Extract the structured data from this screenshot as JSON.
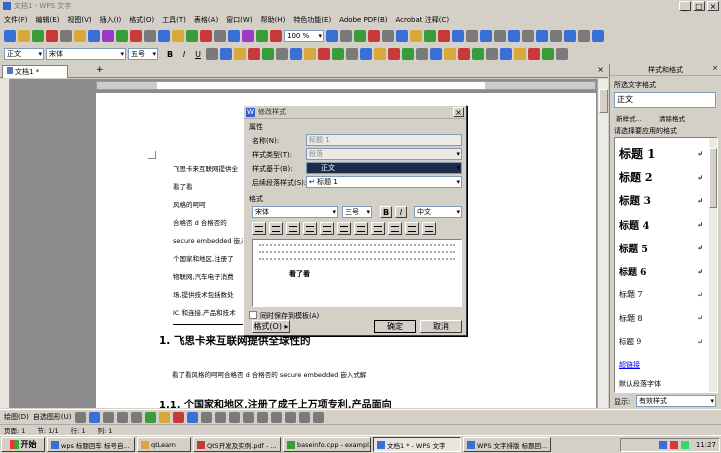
{
  "window": {
    "title": "文档1 - WPS 文字",
    "controls": [
      "_",
      "□",
      "×"
    ]
  },
  "menu": [
    "文件(F)",
    "编辑(E)",
    "视图(V)",
    "插入(I)",
    "格式(O)",
    "工具(T)",
    "表格(A)",
    "窗口(W)",
    "帮助(H)",
    "特色功能(E)",
    "Adobe PDF(B)",
    "Acrobat 注释(C)"
  ],
  "toolbar": {
    "zoom": "100 %",
    "style": "正文",
    "font": "宋体",
    "size": "五号"
  },
  "tabs": [
    {
      "label": "文档1 *"
    }
  ],
  "document": {
    "lines": [
      "飞思卡来互联网提供全",
      "看了看",
      "风格的呵呵",
      "合格否 d 合格否的",
      "secure embedded 嵌入",
      "个国家和地区,注册了",
      "物联网,汽车电子消费",
      "场,提供技术包括数处",
      "IC 和连接,产品和技术"
    ],
    "heading1": "1.  飞思卡来互联网提供全球性的",
    "paragraph": "看了看风格的呵呵合格否 d 合格否的  secure embedded 嵌入式解",
    "heading2": "1.1. 个国家和地区,注册了成千上万项专利,产品面向"
  },
  "dialog": {
    "title": "修改样式",
    "section_props": "属性",
    "name_label": "名称(N):",
    "name_value": "标题 1",
    "type_label": "样式类型(T):",
    "type_value": "段落",
    "based_label": "样式基于(B):",
    "based_value": "正文",
    "next_label": "后续段落样式(S):",
    "next_value": "↵ 标题 1",
    "section_format": "格式",
    "font": "宋体",
    "size": "三号",
    "bold": "B",
    "italic": "I",
    "lang": "中文",
    "preview_text": "看了看",
    "checkbox_label": "同时保存到模板(A)",
    "format_button": "格式(O) ▸",
    "ok": "确定",
    "cancel": "取消"
  },
  "task_pane": {
    "title": "样式和格式",
    "selected_label": "所选文字格式",
    "selected_value": "正文",
    "new_button": "新样式...",
    "clear_button": "清除格式",
    "apply_label": "请选择要应用的格式",
    "styles": [
      {
        "name": "标题  1",
        "size": 12
      },
      {
        "name": "标题  2",
        "size": 11
      },
      {
        "name": "标题  3",
        "size": 10.5
      },
      {
        "name": "标题  4",
        "size": 10
      },
      {
        "name": "标题  5",
        "size": 9.5
      },
      {
        "name": "标题  6",
        "size": 9
      },
      {
        "name": "标题  7",
        "size": 8
      },
      {
        "name": "标题  8",
        "size": 8
      },
      {
        "name": "标题  9",
        "size": 7.5
      }
    ],
    "hyperlink": "超链接",
    "default_font": "默认段落字体",
    "show_label": "显示:",
    "show_value": "有效样式"
  },
  "drawing_toolbar": {
    "label": "绘图(D)",
    "autoshape": "自选图形(U)"
  },
  "status": {
    "left": "页面: 1",
    "section": "节: 1/1",
    "cursor": "行: 1",
    "col": "列: 1"
  },
  "taskbar": {
    "start": "开始",
    "items": [
      "wps 标题回车 标号自...",
      "qtLearn",
      "Qt5开发及实例.pdf - ...",
      "baseinfo.cpp - exampl...",
      "文档1 * - WPS 文字",
      "WPS 文字排版 标题回..."
    ],
    "clock": "11:27"
  }
}
